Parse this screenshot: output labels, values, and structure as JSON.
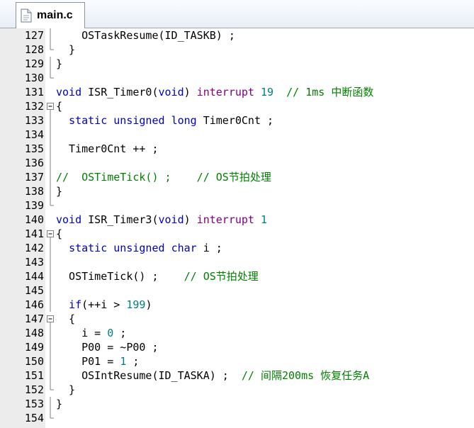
{
  "tab": {
    "title": "main.c"
  },
  "colors": {
    "keyword": "#0000c8",
    "interrupt": "#800080",
    "number": "#008080",
    "comment": "#008000"
  },
  "lines": [
    {
      "num": "127",
      "fold": "line",
      "tokens": [
        {
          "t": "    OSTaskResume(ID_TASKB) ;",
          "c": ""
        }
      ]
    },
    {
      "num": "128",
      "fold": "end",
      "tokens": [
        {
          "t": "  }",
          "c": ""
        }
      ]
    },
    {
      "num": "129",
      "fold": "line",
      "tokens": [
        {
          "t": "}",
          "c": ""
        }
      ]
    },
    {
      "num": "130",
      "fold": "end",
      "tokens": []
    },
    {
      "num": "131",
      "fold": "none",
      "tokens": [
        {
          "t": "void",
          "c": "kw"
        },
        {
          "t": " ISR_Timer0(",
          "c": ""
        },
        {
          "t": "void",
          "c": "kw"
        },
        {
          "t": ") ",
          "c": ""
        },
        {
          "t": "interrupt",
          "c": "kw2"
        },
        {
          "t": " ",
          "c": ""
        },
        {
          "t": "19",
          "c": "num"
        },
        {
          "t": "  // 1ms 中断函数",
          "c": "cm"
        }
      ]
    },
    {
      "num": "132",
      "fold": "box",
      "tokens": [
        {
          "t": "{",
          "c": ""
        }
      ]
    },
    {
      "num": "133",
      "fold": "line",
      "tokens": [
        {
          "t": "  ",
          "c": ""
        },
        {
          "t": "static",
          "c": "kw"
        },
        {
          "t": " ",
          "c": ""
        },
        {
          "t": "unsigned",
          "c": "kw"
        },
        {
          "t": " ",
          "c": ""
        },
        {
          "t": "long",
          "c": "kw"
        },
        {
          "t": " Timer0Cnt ;",
          "c": ""
        }
      ]
    },
    {
      "num": "134",
      "fold": "line",
      "tokens": []
    },
    {
      "num": "135",
      "fold": "line",
      "tokens": [
        {
          "t": "  Timer0Cnt ++ ;",
          "c": ""
        }
      ]
    },
    {
      "num": "136",
      "fold": "line",
      "tokens": []
    },
    {
      "num": "137",
      "fold": "line",
      "tokens": [
        {
          "t": "//  OSTimeTick() ;    // OS节拍处理",
          "c": "cm"
        }
      ]
    },
    {
      "num": "138",
      "fold": "line",
      "tokens": [
        {
          "t": "}",
          "c": ""
        }
      ]
    },
    {
      "num": "139",
      "fold": "end",
      "tokens": []
    },
    {
      "num": "140",
      "fold": "none",
      "tokens": [
        {
          "t": "void",
          "c": "kw"
        },
        {
          "t": " ISR_Timer3(",
          "c": ""
        },
        {
          "t": "void",
          "c": "kw"
        },
        {
          "t": ") ",
          "c": ""
        },
        {
          "t": "interrupt",
          "c": "kw2"
        },
        {
          "t": " ",
          "c": ""
        },
        {
          "t": "1",
          "c": "num"
        }
      ]
    },
    {
      "num": "141",
      "fold": "box",
      "tokens": [
        {
          "t": "{",
          "c": ""
        }
      ]
    },
    {
      "num": "142",
      "fold": "line",
      "tokens": [
        {
          "t": "  ",
          "c": ""
        },
        {
          "t": "static",
          "c": "kw"
        },
        {
          "t": " ",
          "c": ""
        },
        {
          "t": "unsigned",
          "c": "kw"
        },
        {
          "t": " ",
          "c": ""
        },
        {
          "t": "char",
          "c": "kw"
        },
        {
          "t": " i ;",
          "c": ""
        }
      ]
    },
    {
      "num": "143",
      "fold": "line",
      "tokens": []
    },
    {
      "num": "144",
      "fold": "line",
      "tokens": [
        {
          "t": "  OSTimeTick() ;    ",
          "c": ""
        },
        {
          "t": "// OS节拍处理",
          "c": "cm"
        }
      ]
    },
    {
      "num": "145",
      "fold": "line",
      "tokens": []
    },
    {
      "num": "146",
      "fold": "line",
      "tokens": [
        {
          "t": "  ",
          "c": ""
        },
        {
          "t": "if",
          "c": "kw"
        },
        {
          "t": "(++i > ",
          "c": ""
        },
        {
          "t": "199",
          "c": "num"
        },
        {
          "t": ")",
          "c": ""
        }
      ]
    },
    {
      "num": "147",
      "fold": "box",
      "tokens": [
        {
          "t": "  {",
          "c": ""
        }
      ]
    },
    {
      "num": "148",
      "fold": "line",
      "tokens": [
        {
          "t": "    i = ",
          "c": ""
        },
        {
          "t": "0",
          "c": "num"
        },
        {
          "t": " ;",
          "c": ""
        }
      ]
    },
    {
      "num": "149",
      "fold": "line",
      "tokens": [
        {
          "t": "    P00 = ~P00 ;",
          "c": ""
        }
      ]
    },
    {
      "num": "150",
      "fold": "line",
      "tokens": [
        {
          "t": "    P01 = ",
          "c": ""
        },
        {
          "t": "1",
          "c": "num"
        },
        {
          "t": " ;",
          "c": ""
        }
      ]
    },
    {
      "num": "151",
      "fold": "line",
      "tokens": [
        {
          "t": "    OSIntResume(ID_TASKA) ;  ",
          "c": ""
        },
        {
          "t": "// 间隔200ms 恢复任务A",
          "c": "cm"
        }
      ]
    },
    {
      "num": "152",
      "fold": "end",
      "tokens": [
        {
          "t": "  }",
          "c": ""
        }
      ]
    },
    {
      "num": "153",
      "fold": "line",
      "tokens": [
        {
          "t": "}",
          "c": ""
        }
      ]
    },
    {
      "num": "154",
      "fold": "end",
      "tokens": []
    }
  ]
}
